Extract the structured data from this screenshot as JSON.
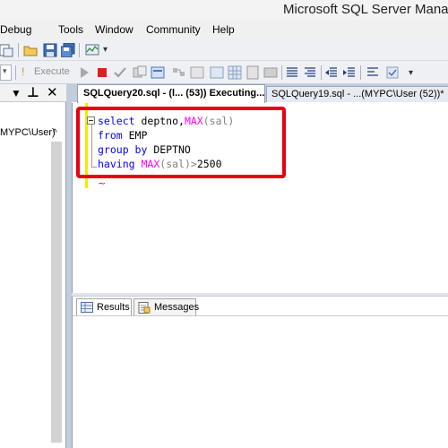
{
  "window": {
    "title": "Microsoft SQL Server Manage"
  },
  "menu": {
    "items": [
      "Debug",
      "Tools",
      "Window",
      "Community",
      "Help"
    ]
  },
  "toolbar": {
    "execute_label": "Execute"
  },
  "object_explorer": {
    "tree_item": "MYPC\\User)"
  },
  "tabs": [
    {
      "label": "SQLQuery20.sql - (l... (53)) Executing...",
      "active": true
    },
    {
      "label": "SQLQuery19.sql - ...(MYPC\\User (52))*",
      "active": false
    }
  ],
  "editor": {
    "lines": [
      {
        "tokens": [
          {
            "t": "select",
            "c": "kw"
          },
          {
            "t": " deptno,",
            "c": "tx"
          },
          {
            "t": "MAX",
            "c": "fn"
          },
          {
            "t": "(sal)",
            "c": "op"
          }
        ]
      },
      {
        "tokens": [
          {
            "t": "from",
            "c": "kw"
          },
          {
            "t": " EMP",
            "c": "tx"
          }
        ]
      },
      {
        "tokens": [
          {
            "t": "group by",
            "c": "kw"
          },
          {
            "t": " DEPTNO",
            "c": "tx"
          }
        ]
      },
      {
        "tokens": [
          {
            "t": "having",
            "c": "kw"
          },
          {
            "t": " ",
            "c": "tx"
          },
          {
            "t": "MAX",
            "c": "fn"
          },
          {
            "t": "(sal)>",
            "c": "op"
          },
          {
            "t": "2500",
            "c": "tx"
          }
        ]
      }
    ]
  },
  "results": {
    "tabs": [
      {
        "label": "Results",
        "active": true
      },
      {
        "label": "Messages",
        "active": false
      }
    ]
  },
  "colors": {
    "keyword": "#0000ff",
    "function": "#ff00ff",
    "operator": "#808080",
    "highlight": "#e8000f"
  }
}
